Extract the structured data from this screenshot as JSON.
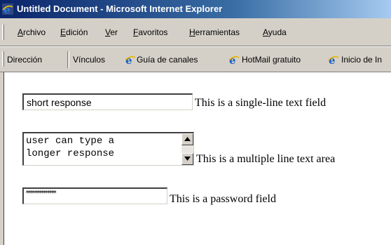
{
  "window": {
    "title": "Untitled Document - Microsoft Internet Explorer"
  },
  "menu": {
    "items": [
      "Archivo",
      "Edición",
      "Ver",
      "Favoritos",
      "Herramientas",
      "Ayuda"
    ]
  },
  "links_bar": {
    "address_label": "Dirección",
    "links_label": "Vínculos",
    "links": [
      "Guía de canales",
      "HotMail gratuito",
      "Inicio de In"
    ]
  },
  "form": {
    "text_field": {
      "value": "short response",
      "caption": "This is a single-line text field"
    },
    "text_area": {
      "value": "user can type a\nlonger response",
      "caption": "This is a multiple line text area"
    },
    "password_field": {
      "masked_value": "**************",
      "caption": "This is a password field"
    }
  },
  "colors": {
    "titlebar_start": "#0a246a",
    "titlebar_end": "#a6caf0",
    "chrome": "#d4d0c8"
  }
}
